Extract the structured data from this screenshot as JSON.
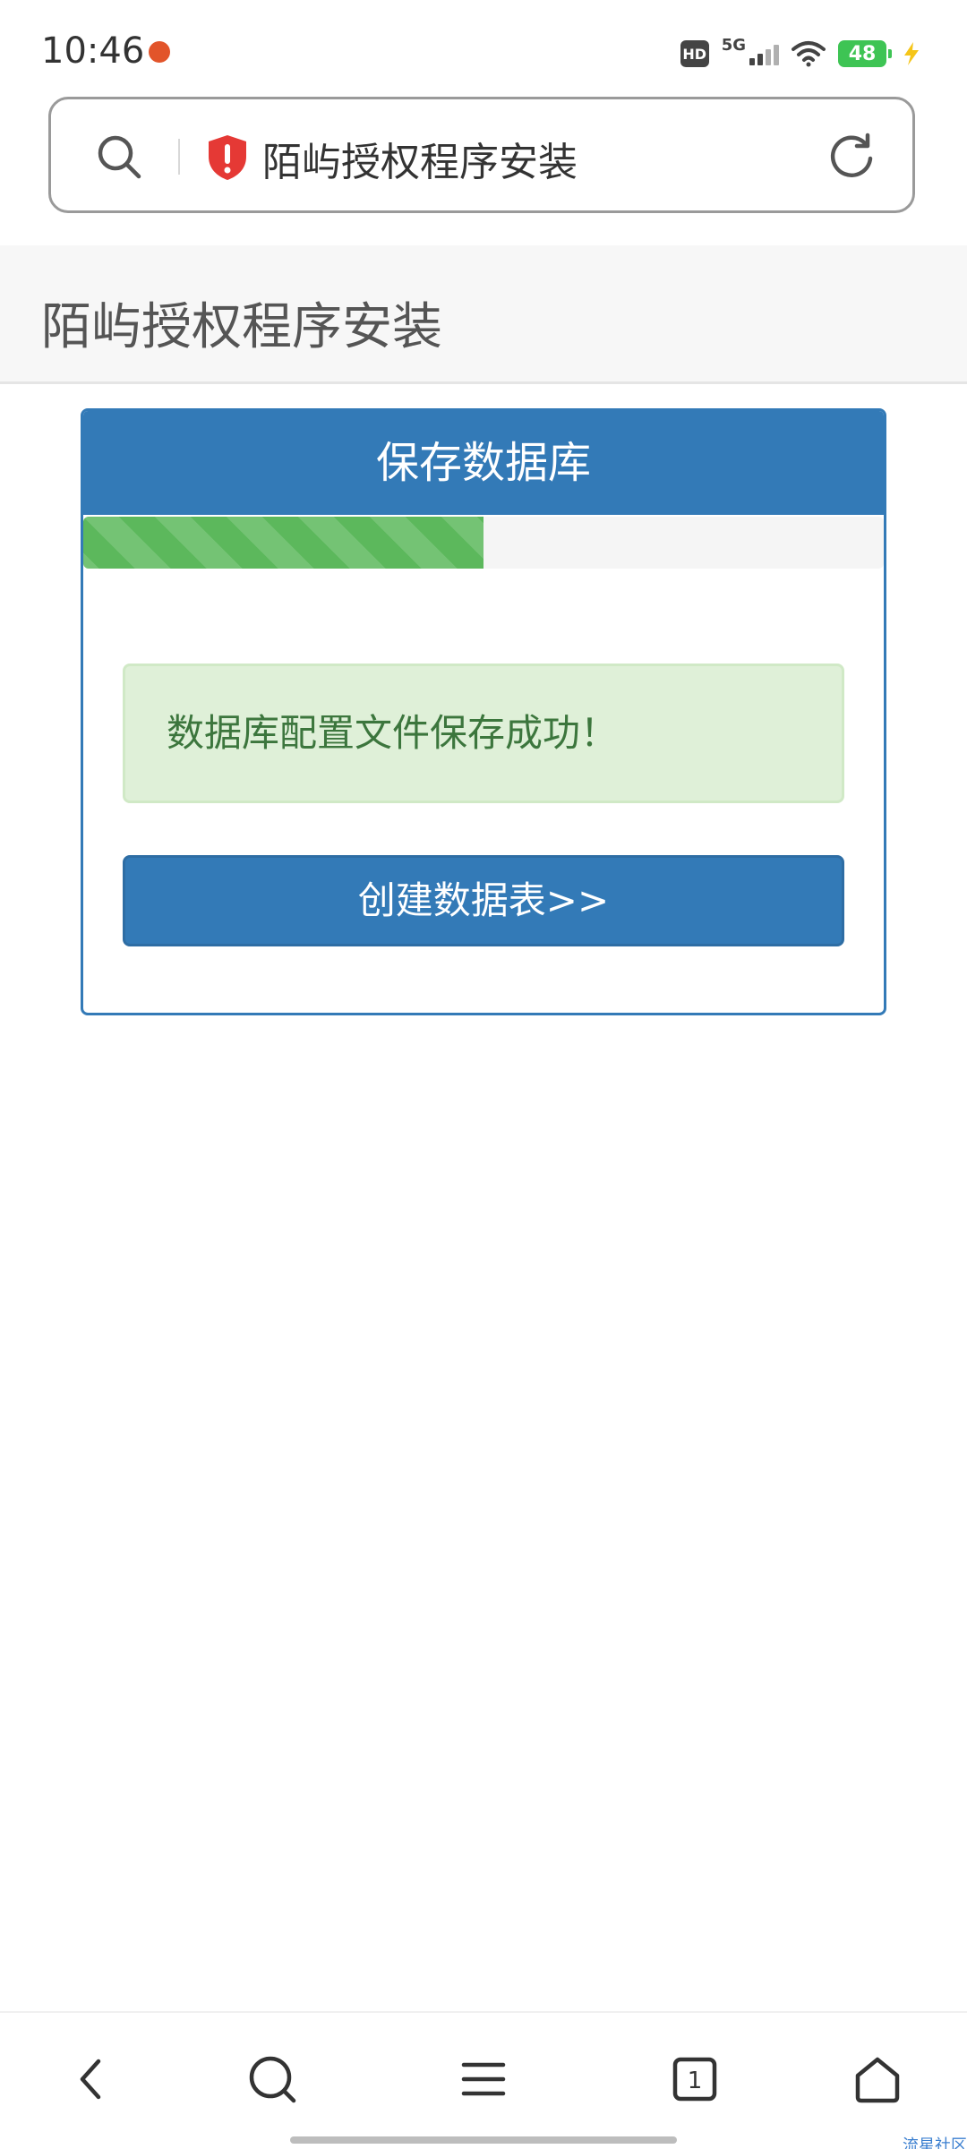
{
  "status_bar": {
    "time": "10:46",
    "network": "5G",
    "hd_label": "HD",
    "battery": "48"
  },
  "address_bar": {
    "title": "陌屿授权程序安装"
  },
  "page": {
    "header_title": "陌屿授权程序安装"
  },
  "panel": {
    "title": "保存数据库",
    "progress_fraction": 0.5,
    "alert_message": "数据库配置文件保存成功！",
    "button_label": "创建数据表>>"
  },
  "bottom_nav": {
    "tab_count": "1"
  },
  "watermark": "流星社区",
  "colors": {
    "primary": "#337ab7",
    "success_bg": "#dff0d8",
    "success_text": "#3c763d",
    "progress": "#5cb85c",
    "warning_shield": "#e53935",
    "battery": "#3ec454"
  }
}
